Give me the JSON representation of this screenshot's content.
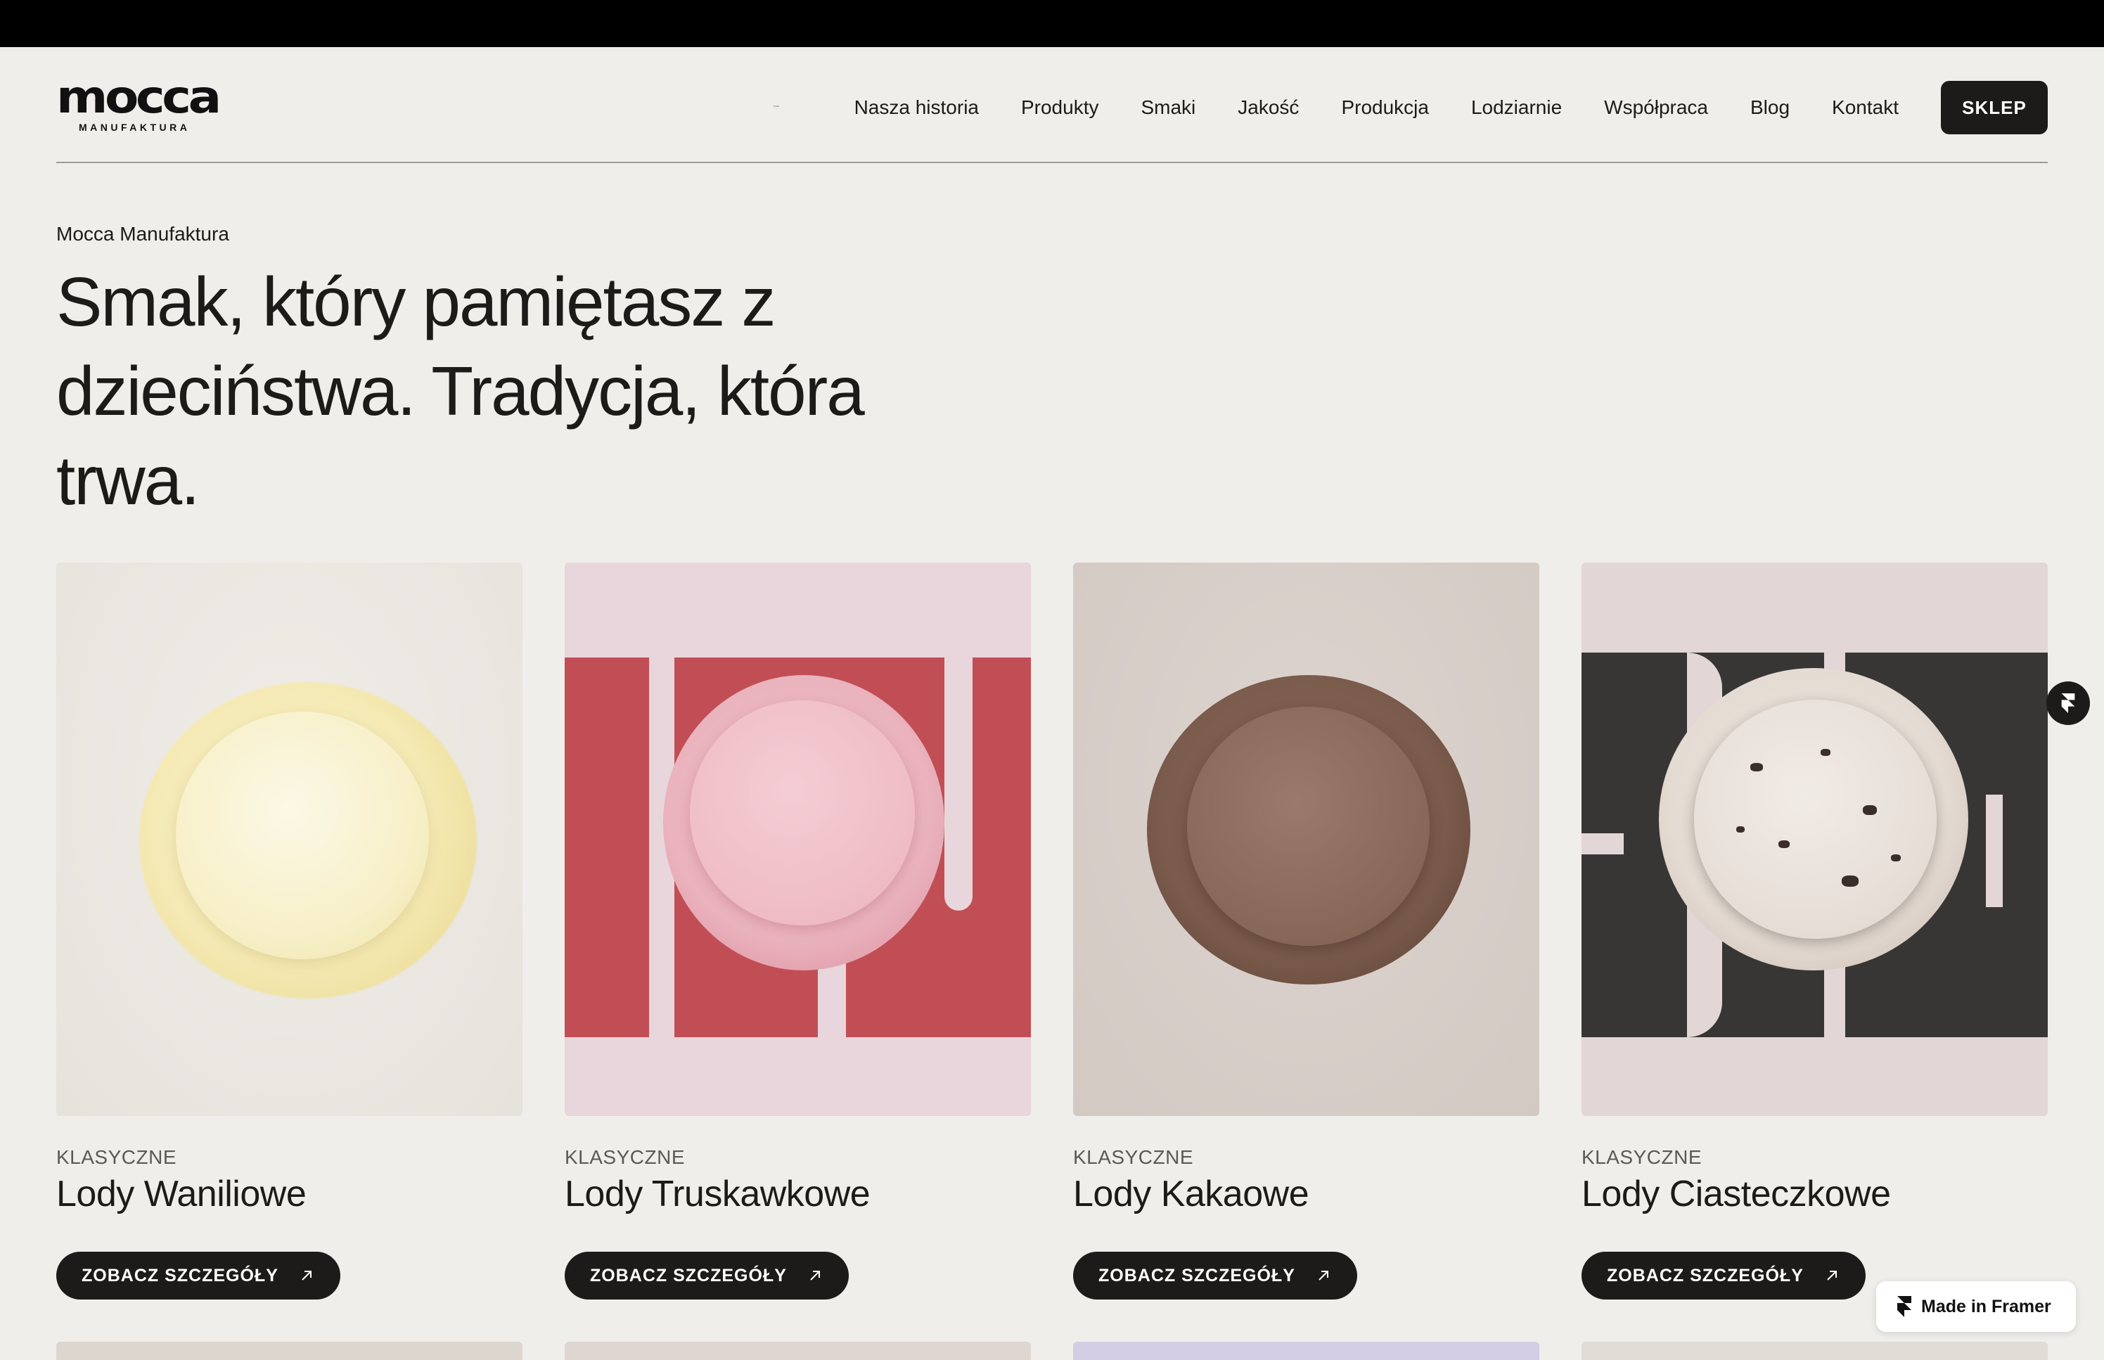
{
  "brand": {
    "name": "mocca",
    "sub": "MANUFAKTURA"
  },
  "nav": {
    "items": [
      "Nasza historia",
      "Produkty",
      "Smaki",
      "Jakość",
      "Produkcja",
      "Lodziarnie",
      "Współpraca",
      "Blog",
      "Kontakt"
    ],
    "shop_label": "SKLEP"
  },
  "hero": {
    "eyebrow": "Mocca Manufaktura",
    "headline": "Smak, który pamiętasz z dzieciństwa. Tradycja, która trwa."
  },
  "products": [
    {
      "category": "KLASYCZNE",
      "title": "Lody Waniliowe",
      "button": "ZOBACZ SZCZEGÓŁY",
      "bg": "#e9e5df",
      "flavor": "vanilla"
    },
    {
      "category": "KLASYCZNE",
      "title": "Lody Truskawkowe",
      "button": "ZOBACZ SZCZEGÓŁY",
      "bg": "#e8d6dc",
      "flavor": "strawberry"
    },
    {
      "category": "KLASYCZNE",
      "title": "Lody Kakaowe",
      "button": "ZOBACZ SZCZEGÓŁY",
      "bg": "#d8cfca",
      "flavor": "cocoa"
    },
    {
      "category": "KLASYCZNE",
      "title": "Lody Ciasteczkowe",
      "button": "ZOBACZ SZCZEGÓŁY",
      "bg": "#e2d7d6",
      "flavor": "cookie"
    }
  ],
  "badge": {
    "label": "Made in Framer"
  },
  "icons": {
    "arrow": "arrow-up-right-icon",
    "framer": "framer-logo-icon"
  }
}
